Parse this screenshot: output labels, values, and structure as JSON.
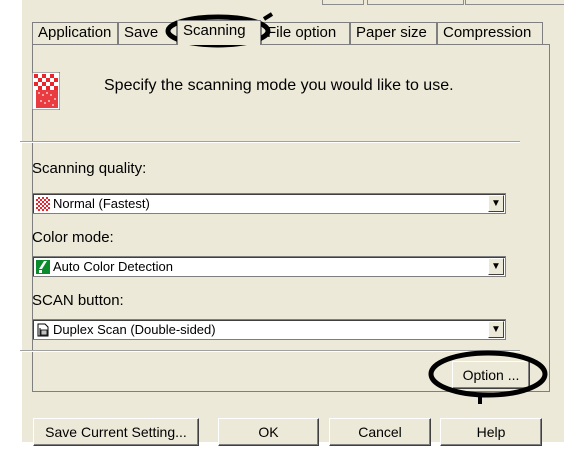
{
  "tabs": [
    {
      "label": "Application"
    },
    {
      "label": "Save"
    },
    {
      "label": "Scanning"
    },
    {
      "label": "File option"
    },
    {
      "label": "Paper size"
    },
    {
      "label": "Compression"
    }
  ],
  "intro": {
    "text": "Specify the scanning mode you would like to use."
  },
  "fields": {
    "scanning_quality": {
      "label": "Scanning quality:",
      "value": "Normal (Fastest)"
    },
    "color_mode": {
      "label": "Color mode:",
      "value": "Auto Color Detection"
    },
    "scan_button": {
      "label": "SCAN button:",
      "value": "Duplex Scan (Double-sided)"
    }
  },
  "option_button": {
    "label": "Option ..."
  },
  "buttons": {
    "save_current": "Save Current Setting...",
    "ok": "OK",
    "cancel": "Cancel",
    "help": "Help"
  },
  "icons": {
    "quality": "checker-icon",
    "color_mode": "color-detect-icon",
    "scan_button": "duplex-doc-icon"
  },
  "colors": {
    "dialog_bg": "#ece9d8",
    "checker_red": "#e8262b",
    "color_green": "#0a8a2a"
  }
}
